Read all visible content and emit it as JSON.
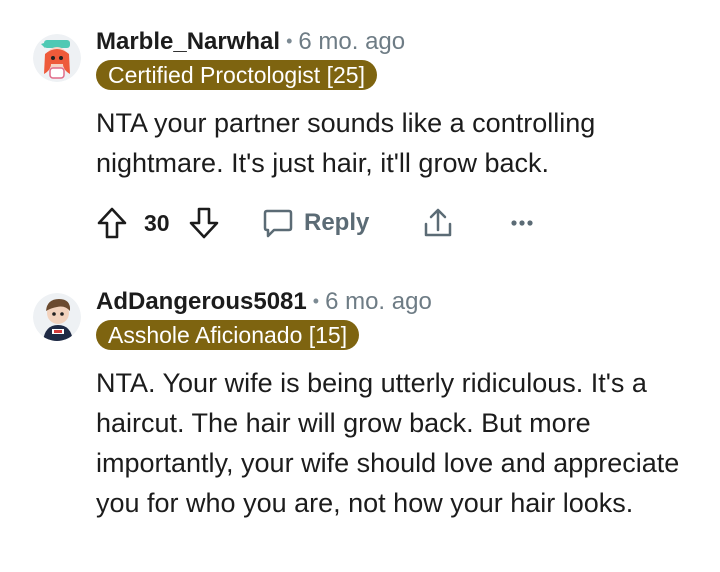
{
  "comments": [
    {
      "username": "Marble_Narwhal",
      "separator": "•",
      "age": "6 mo. ago",
      "flair": "Certified Proctologist [25]",
      "body": "NTA your partner sounds like a controlling nightmare. It's just hair, it'll grow back.",
      "score": "30",
      "reply_label": "Reply",
      "avatar_icon": "narwhal-avatar-icon"
    },
    {
      "username": "AdDangerous5081",
      "separator": "•",
      "age": "6 mo. ago",
      "flair": "Asshole Aficionado [15]",
      "body": "NTA. Your wife is being utterly ridiculous. It's a haircut. The hair will grow back. But more importantly, your wife should love and appreciate you for who you are, not how your hair looks.",
      "avatar_icon": "user-avatar-icon"
    }
  ],
  "icons": {
    "upvote": "arrow-up-icon",
    "downvote": "arrow-down-icon",
    "reply": "chat-bubble-icon",
    "share": "share-icon",
    "more": "more-dots-icon"
  },
  "colors": {
    "flair_bg": "#7e6410",
    "flair_text": "#ffffff",
    "meta_text": "#6e7c85",
    "icon_gray": "#5b6b75"
  }
}
